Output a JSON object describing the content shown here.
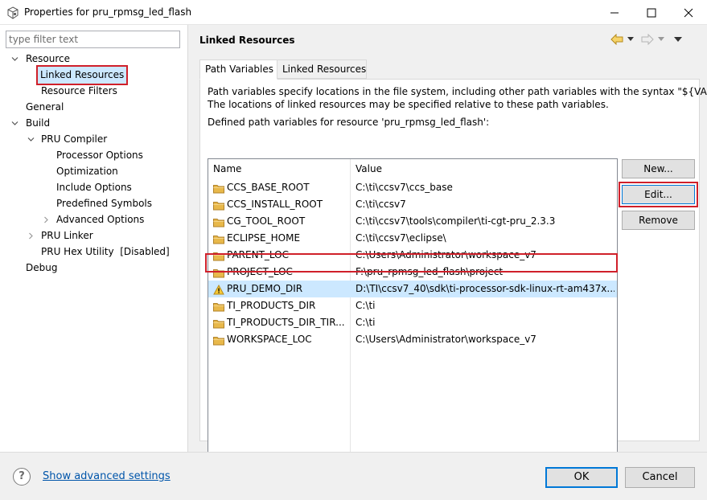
{
  "window": {
    "title": "Properties for pru_rpmsg_led_flash"
  },
  "filter": {
    "placeholder": "type filter text"
  },
  "tree": {
    "resource": "Resource",
    "linked_resources": "Linked Resources",
    "resource_filters": "Resource Filters",
    "general": "General",
    "build": "Build",
    "pru_compiler": "PRU Compiler",
    "processor_options": "Processor Options",
    "optimization": "Optimization",
    "include_options": "Include Options",
    "predefined_symbols": "Predefined Symbols",
    "advanced_options": "Advanced Options",
    "pru_linker": "PRU Linker",
    "pru_hex_utility": "PRU Hex Utility  [Disabled]",
    "debug": "Debug"
  },
  "page": {
    "title": "Linked Resources"
  },
  "tabs": [
    {
      "label": "Path Variables",
      "active": true
    },
    {
      "label": "Linked Resources",
      "active": false
    }
  ],
  "description": {
    "line1": "Path variables specify locations in the file system, including other path variables with the syntax \"${VAR}\".",
    "line2": "The locations of linked resources may be specified relative to these path variables.",
    "line3": "Defined path variables for resource 'pru_rpmsg_led_flash':"
  },
  "table": {
    "headers": {
      "name": "Name",
      "value": "Value"
    },
    "rows": [
      {
        "name": "CCS_BASE_ROOT",
        "value": "C:\\ti\\ccsv7\\ccs_base",
        "icon": "folder-icon"
      },
      {
        "name": "CCS_INSTALL_ROOT",
        "value": "C:\\ti\\ccsv7",
        "icon": "folder-icon"
      },
      {
        "name": "CG_TOOL_ROOT",
        "value": "C:\\ti\\ccsv7\\tools\\compiler\\ti-cgt-pru_2.3.3",
        "icon": "folder-icon"
      },
      {
        "name": "ECLIPSE_HOME",
        "value": "C:\\ti\\ccsv7\\eclipse\\",
        "icon": "folder-icon"
      },
      {
        "name": "PARENT_LOC",
        "value": "C:\\Users\\Administrator\\workspace_v7",
        "icon": "folder-icon"
      },
      {
        "name": "PROJECT_LOC",
        "value": "F:\\pru_rpmsg_led_flash\\project",
        "icon": "folder-icon"
      },
      {
        "name": "PRU_DEMO_DIR",
        "value": "D:\\TI\\ccsv7_40\\sdk\\ti-processor-sdk-linux-rt-am437x...",
        "icon": "warning-icon"
      },
      {
        "name": "TI_PRODUCTS_DIR",
        "value": "C:\\ti",
        "icon": "folder-icon"
      },
      {
        "name": "TI_PRODUCTS_DIR_TIR...",
        "value": "C:\\ti",
        "icon": "folder-icon"
      },
      {
        "name": "WORKSPACE_LOC",
        "value": "C:\\Users\\Administrator\\workspace_v7",
        "icon": "folder-icon"
      }
    ]
  },
  "buttons": {
    "new": "New...",
    "edit": "Edit...",
    "remove": "Remove",
    "ok": "OK",
    "cancel": "Cancel"
  },
  "footer": {
    "help": "?",
    "advanced_link": "Show advanced settings"
  },
  "colors": {
    "highlight_red": "#d0202a",
    "selection": "#cce8ff",
    "link": "#0055aa",
    "folder": "#e8b84a"
  }
}
